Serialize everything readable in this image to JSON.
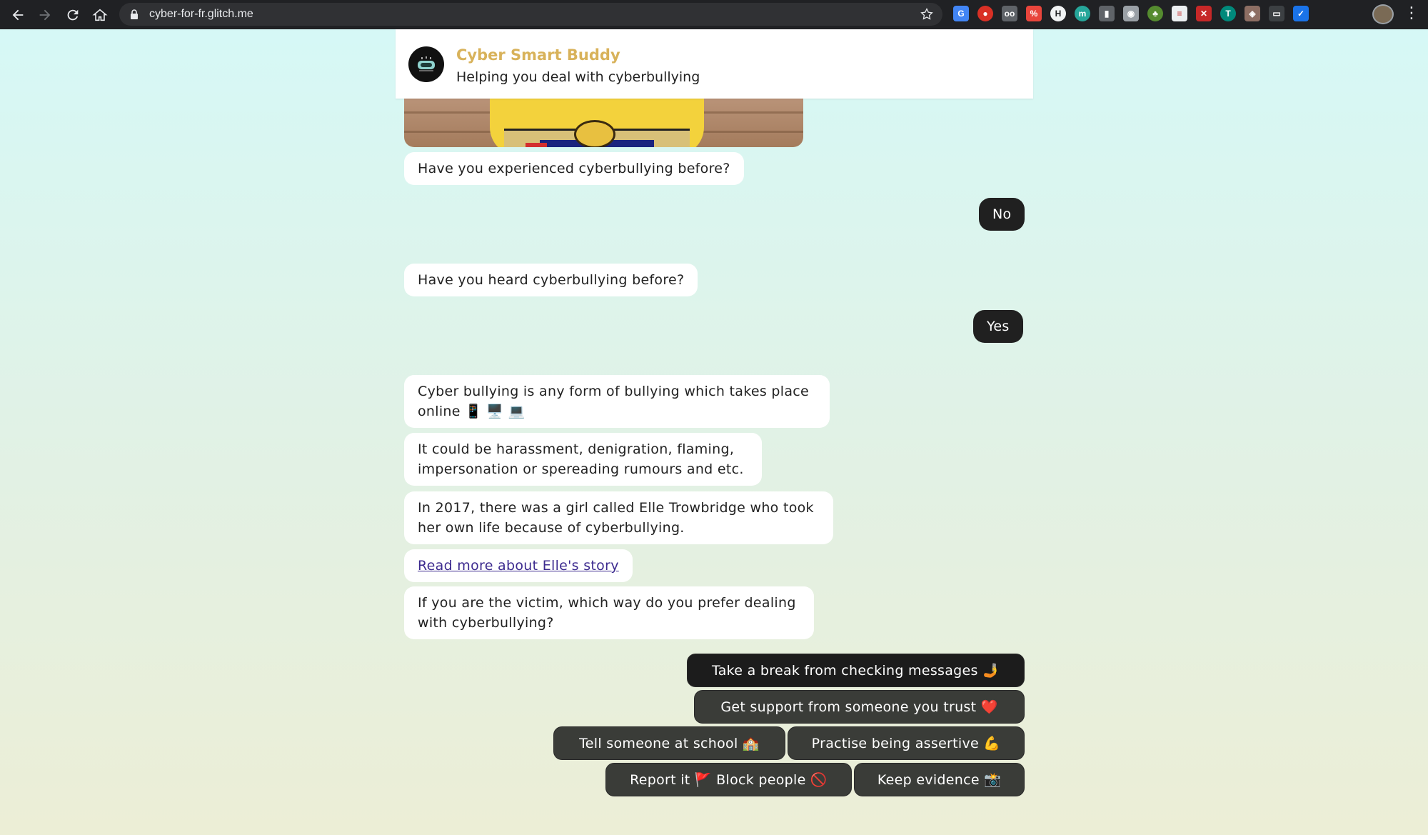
{
  "browser": {
    "url": "cyber-for-fr.glitch.me",
    "back_icon": "back-arrow-icon",
    "forward_icon": "forward-arrow-icon",
    "reload_icon": "reload-icon",
    "home_icon": "home-icon"
  },
  "header": {
    "title": "Cyber Smart Buddy",
    "subtitle": "Helping you deal with cyberbullying",
    "title_color": "#d8b25a"
  },
  "messages": {
    "q1": "Have you experienced cyberbullying before?",
    "a1": "No",
    "q2": "Have you heard cyberbullying before?",
    "a2": "Yes",
    "m1_line1": "Cyber bullying is any form of bullying which takes place",
    "m1_line2": "online 📱 🖥️ 💻",
    "m2_line1": "It could be harassment, denigration, flaming,",
    "m2_line2": "impersonation or spereading rumours and etc.",
    "m3_line1": "In 2017, there was a girl called Elle Trowbridge who took",
    "m3_line2": "her own life because of cyberbullying.",
    "link": "Read more about Elle's story",
    "m4_line1": "If you are the victim, which way do you prefer dealing",
    "m4_line2": "with cyberbullying?"
  },
  "options": {
    "o1": "Take a break from checking messages 🤳",
    "o2": "Get support from someone you trust ❤️",
    "o3": "Tell someone at school 🏫",
    "o4": "Practise being assertive 💪",
    "o5": "Report it 🚩 Block people 🚫",
    "o6": "Keep evidence 📸"
  }
}
